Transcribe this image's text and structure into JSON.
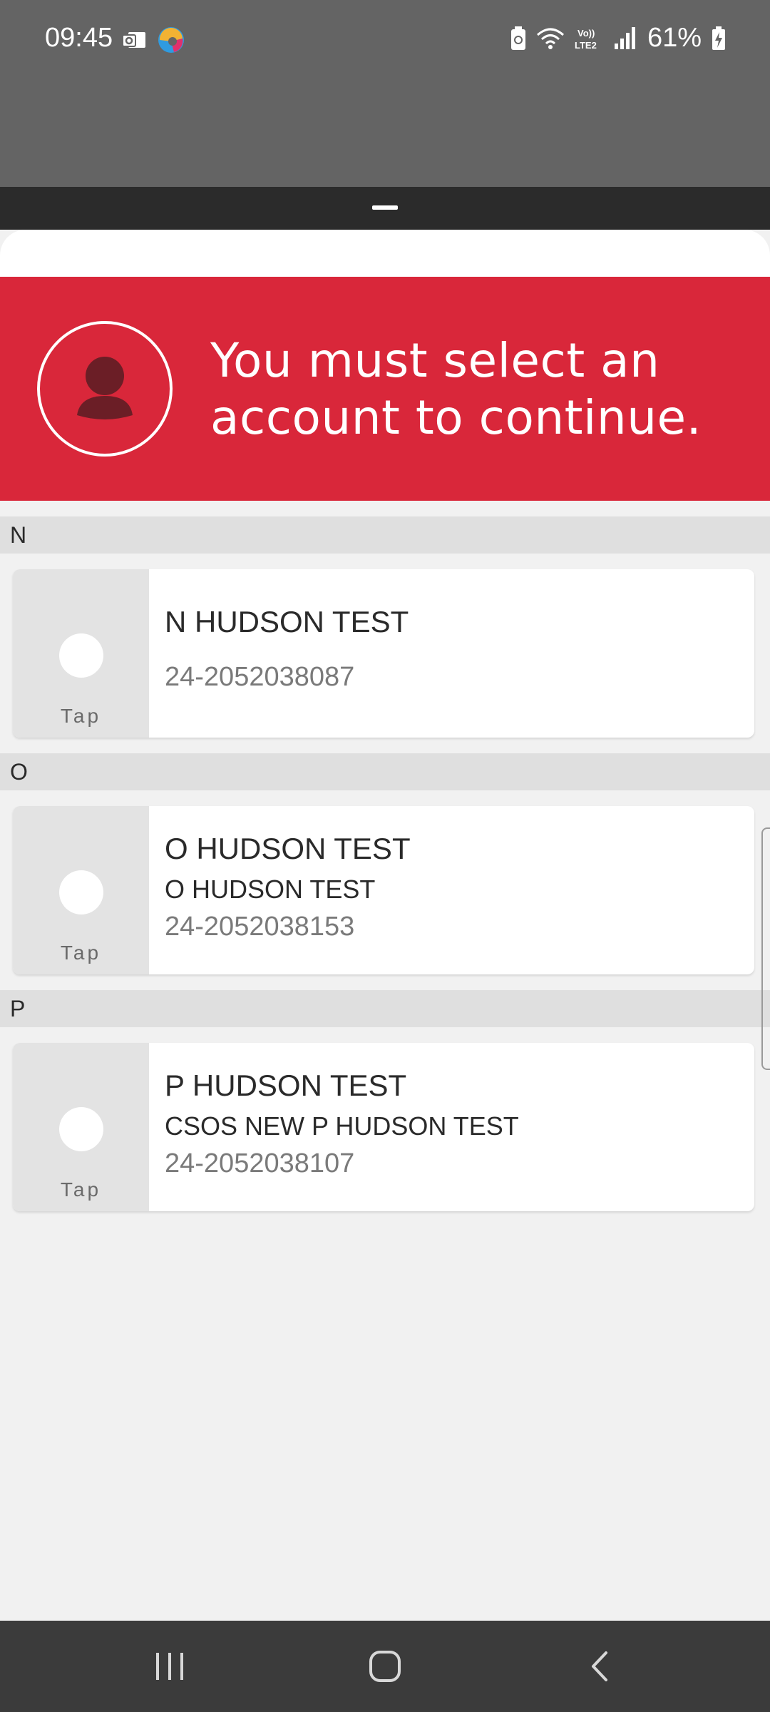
{
  "status_bar": {
    "time": "09:45",
    "battery": "61%",
    "icons": [
      "outlook-icon",
      "edge-icon",
      "battery-saver-icon",
      "wifi-icon",
      "volte-icon",
      "signal-icon",
      "battery-icon"
    ]
  },
  "banner": {
    "message": "You must select an account to continue.",
    "icon": "person-icon",
    "color": "#d9273a"
  },
  "accounts": [
    {
      "section": "N",
      "tap_label": "Tap",
      "title": "N HUDSON TEST",
      "subtitle": "",
      "number": "24-2052038087"
    },
    {
      "section": "O",
      "tap_label": "Tap",
      "title": "O HUDSON TEST",
      "subtitle": "O HUDSON TEST",
      "number": "24-2052038153"
    },
    {
      "section": "P",
      "tap_label": "Tap",
      "title": "P HUDSON TEST",
      "subtitle": "CSOS NEW P HUDSON TEST",
      "number": "24-2052038107"
    }
  ],
  "nav": {
    "buttons": [
      "recents-icon",
      "home-icon",
      "back-icon"
    ]
  }
}
